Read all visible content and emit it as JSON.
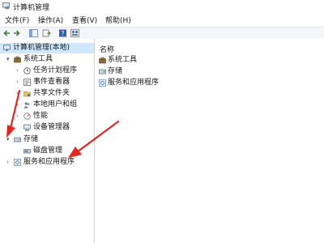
{
  "window": {
    "title": "计算机管理"
  },
  "menu": [
    {
      "label": "文件(F)"
    },
    {
      "label": "操作(A)"
    },
    {
      "label": "查看(V)"
    },
    {
      "label": "帮助(H)"
    }
  ],
  "tree": {
    "root": "计算机管理(本地)",
    "system_tools": "系统工具",
    "task_scheduler": "任务计划程序",
    "event_viewer": "事件查看器",
    "shared_folders": "共享文件夹",
    "local_users": "本地用户和组",
    "performance": "性能",
    "device_manager": "设备管理器",
    "storage": "存储",
    "disk_management": "磁盘管理",
    "services_apps": "服务和应用程序"
  },
  "details": {
    "column_name": "名称",
    "items": [
      "系统工具",
      "存储",
      "服务和应用程序"
    ]
  },
  "colors": {
    "selection": "#cde8ff",
    "arrow": "#e8251f"
  }
}
